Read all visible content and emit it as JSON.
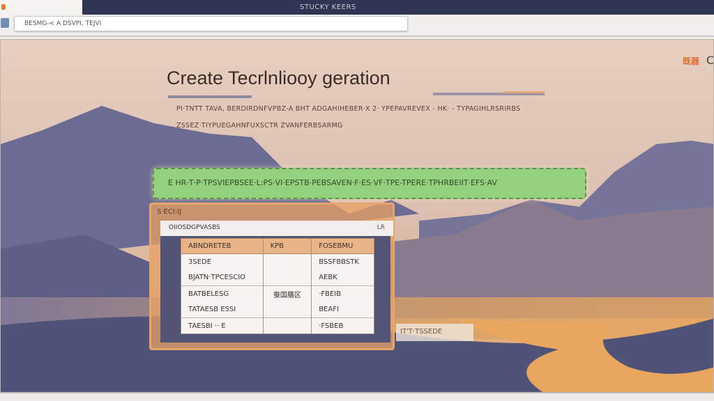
{
  "window": {
    "title": "STUCKY KEERS"
  },
  "toolbar": {
    "address": "BESMG-< A DSVPI, TEJVI"
  },
  "page": {
    "title": "Create Tecrlnliooy geration",
    "subtitle_line1": "PI·TNTT TAVA, BERDIRDNFVPBZ-A BHT ADGAHIHEBER·X 2· YPEPAVREVEX - HK· - TYPAGIHLRSRIRBS",
    "subtitle_line2": "ZSSEZ·TIYPUEGAHNFUXSCTR ZVANFERBSARMG",
    "top_right": "既器",
    "top_right_icon": "C"
  },
  "banner": {
    "text": "E HR·T·P·TPSVIEPBSEE·L:PS·VI·EPSTB·PEBSAVEN·F·ES·VF·TPE-TPERE·TPHRBEIIT·EFS·AV"
  },
  "dialog": {
    "title": "S·ECI:IJ",
    "search_value": "OIIOSDGPVASBS",
    "search_icon": "LR",
    "columns": [
      "ABNDRETEB",
      "KPB",
      "FOSEBMU"
    ],
    "rows": [
      {
        "c1": "3SEDE",
        "c2": "",
        "c3": "BSSFBBSTK"
      },
      {
        "c1": "BJATN·TPCESCIO",
        "c2": "",
        "c3": "AEBK"
      },
      {
        "c1": "BATBELESG",
        "c2": "蚕国膳区",
        "c3": "·FBEIB"
      },
      {
        "c1": "TATAESB ESSI",
        "c2": "",
        "c3": "BEAFI"
      },
      {
        "c1": "TAESBI ·· E",
        "c2": "",
        "c3": "·FSBEB"
      }
    ]
  },
  "caption": {
    "text": "IT'T·TSSEDE"
  },
  "colors": {
    "tabbar": "#2f3552",
    "banner": "#93d17c",
    "dialog": "#e8a56b",
    "header": "#e9b486"
  }
}
